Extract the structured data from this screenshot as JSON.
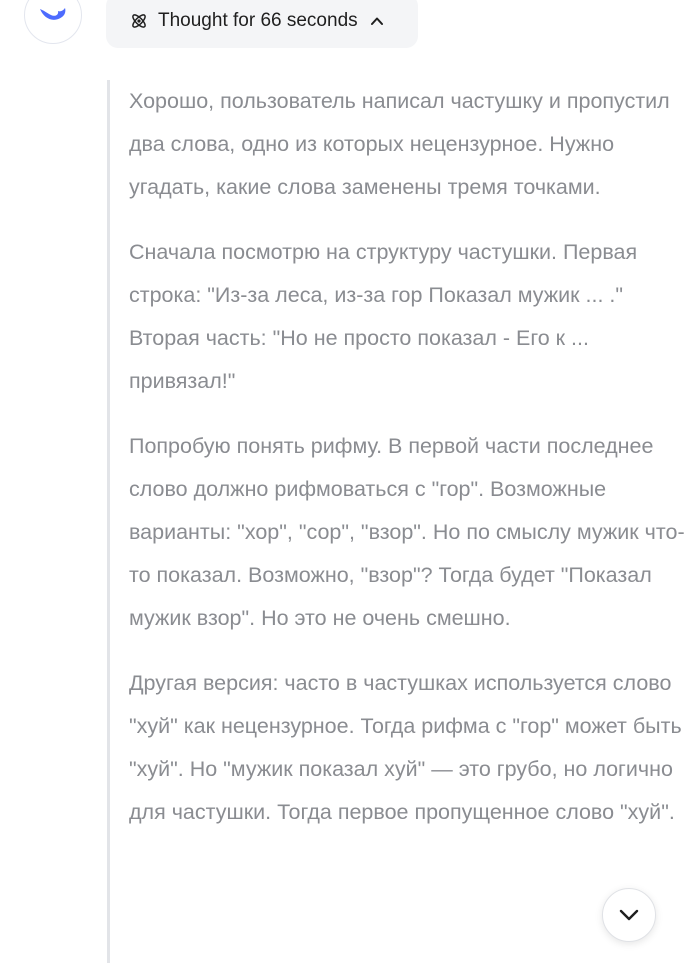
{
  "assistant": {
    "avatar_icon": "whale-logo-icon",
    "brand_color": "#4d6bfe"
  },
  "thought_toggle": {
    "icon": "atom-icon",
    "label": "Thought for 66 seconds",
    "caret_icon": "chevron-up-icon",
    "expanded": true
  },
  "thinking": {
    "paragraphs": [
      "Хорошо, пользователь написал частушку и пропустил два слова, одно из которых нецензурное. Нужно угадать, какие слова заменены тремя точками.",
      "Сначала посмотрю на структуру частушки. Первая строка: \"Из-за леса, из-за гор Показал мужик ... .\" Вторая часть: \"Но не просто показал - Его к ... привязал!\"",
      "Попробую понять рифму. В первой части последнее слово должно рифмоваться с \"гор\". Возможные варианты: \"хор\", \"сор\", \"взор\". Но по смыслу мужик что-то показал. Возможно, \"взор\"? Тогда будет \"Показал мужик взор\". Но это не очень смешно.",
      "Другая версия: часто в частушках используется слово \"хуй\" как нецензурное. Тогда рифма с \"гор\" может быть \"хуй\". Но \"мужик показал хуй\" — это грубо, но логично для частушки. Тогда первое пропущенное слово \"хуй\"."
    ]
  },
  "scroll_down_button": {
    "icon": "chevron-down-icon"
  }
}
